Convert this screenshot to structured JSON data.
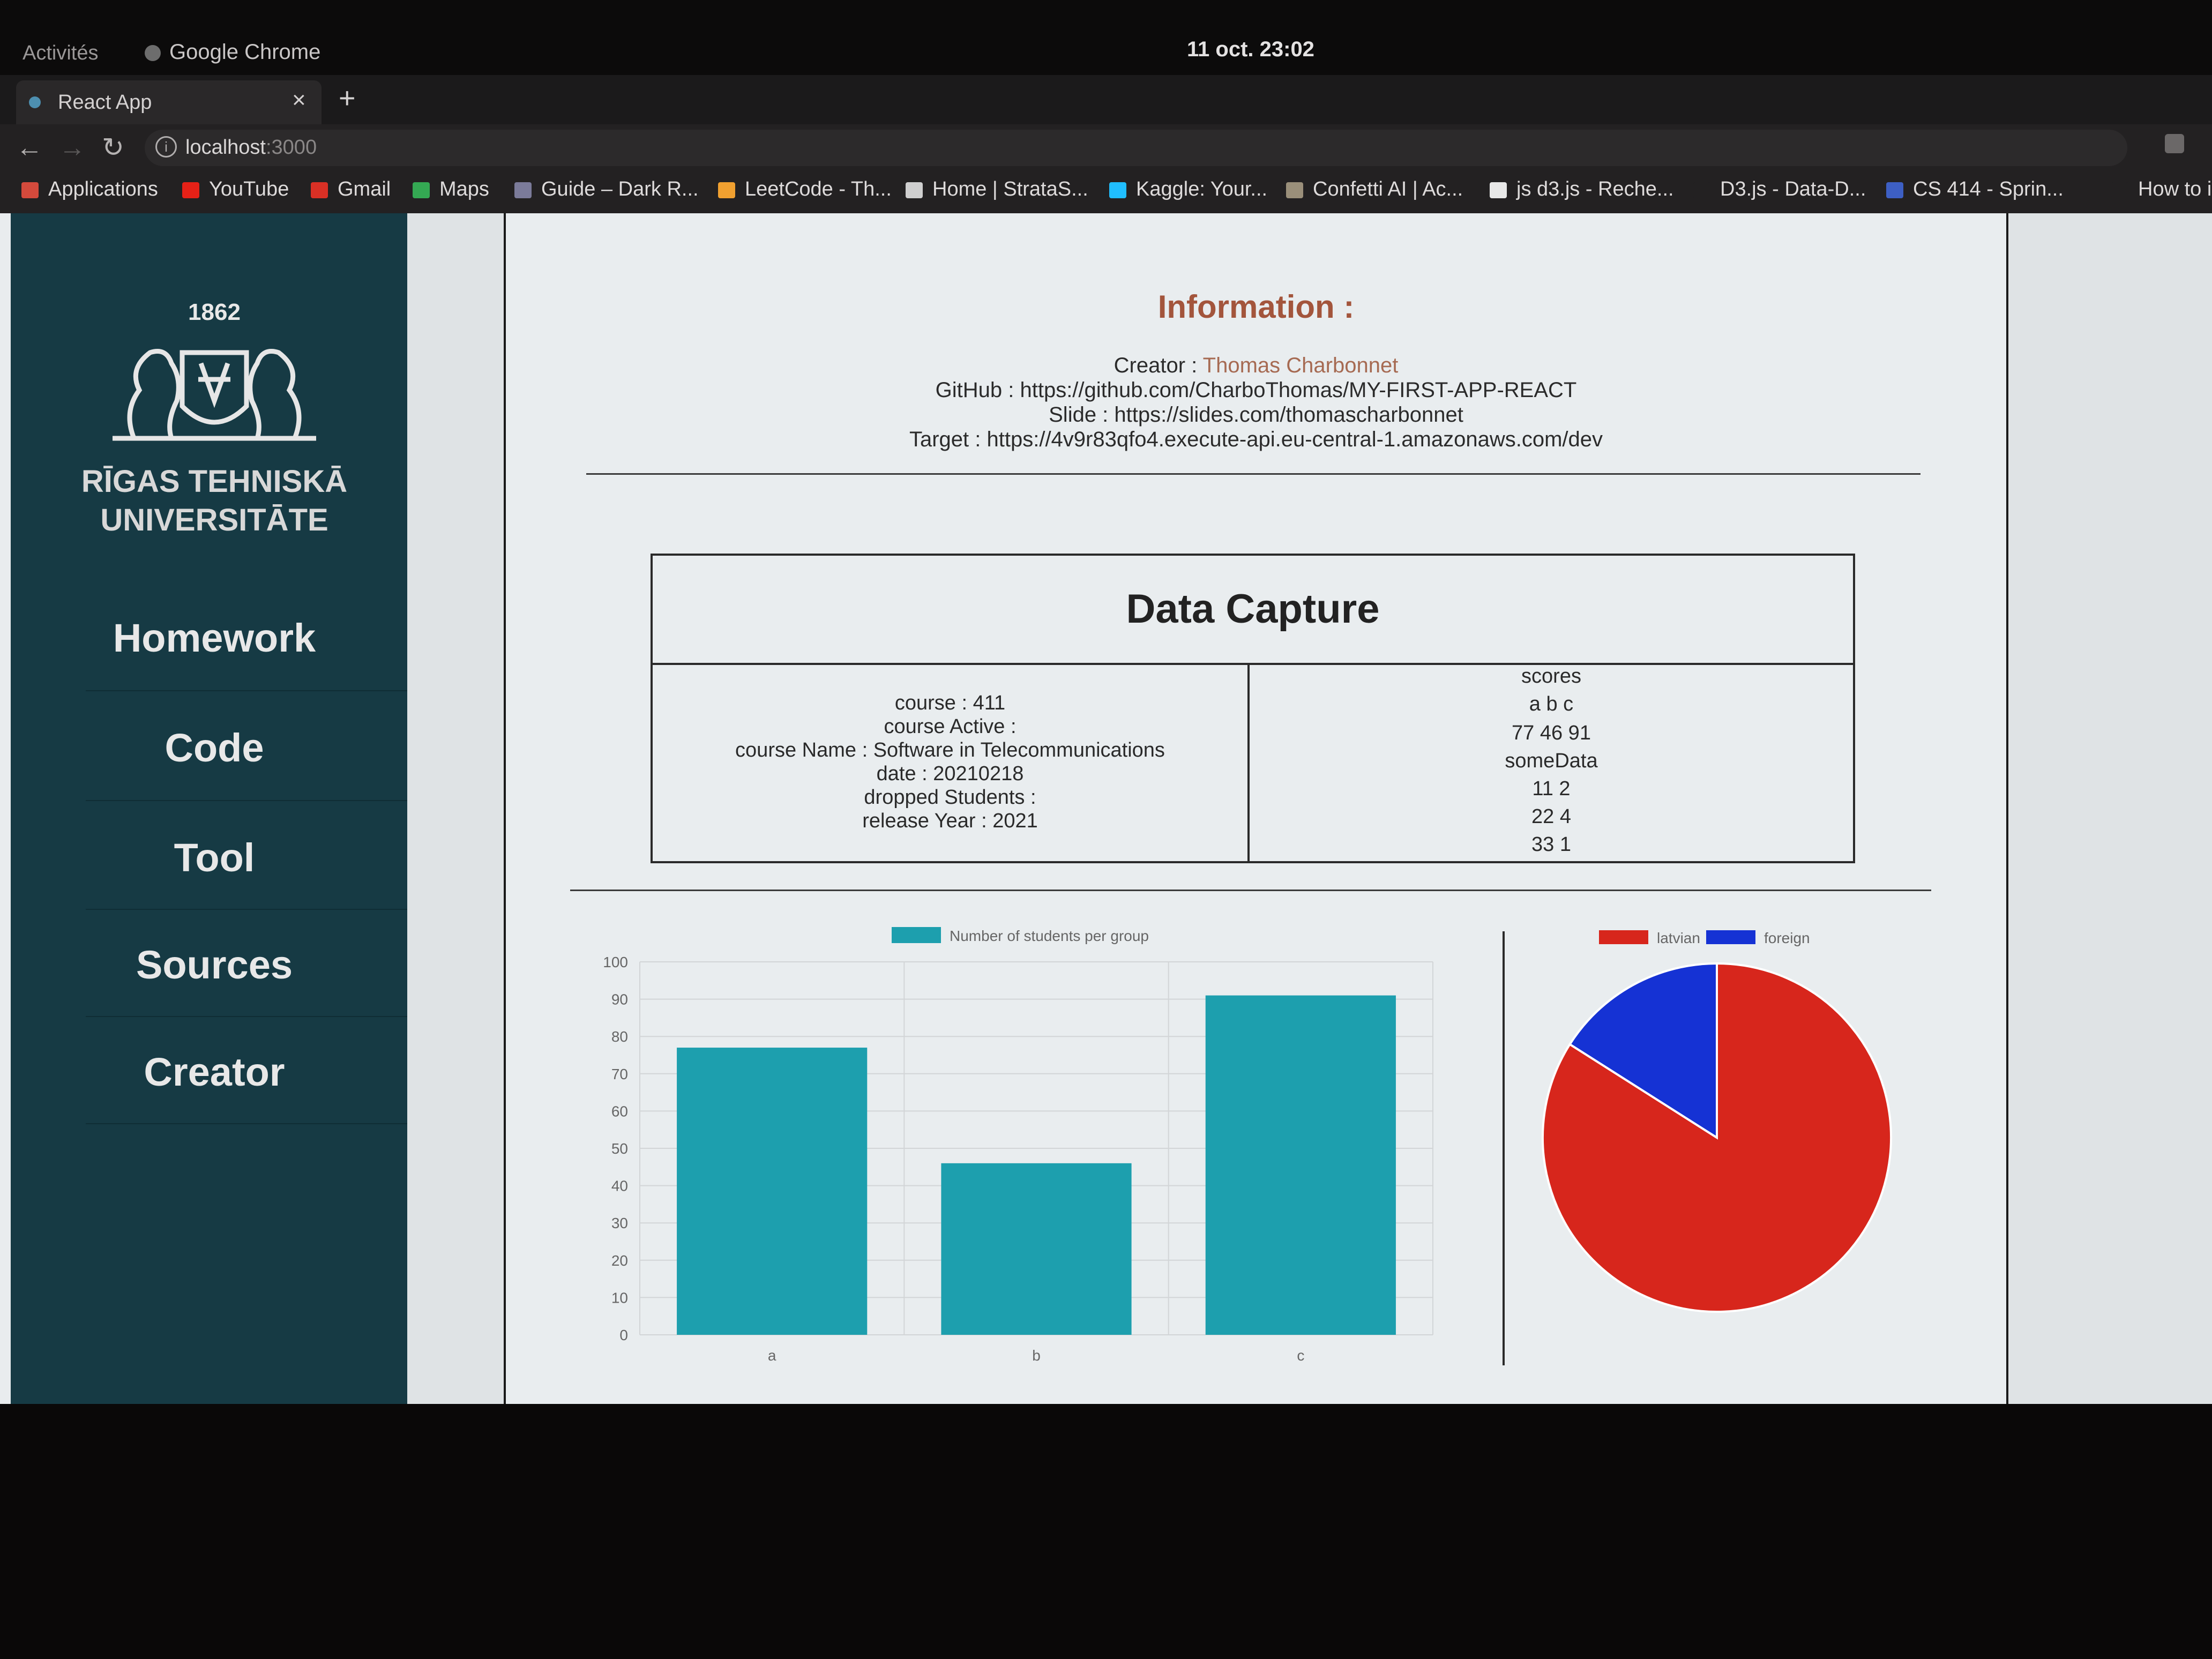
{
  "os": {
    "activities": "Activités",
    "app_name": "Google Chrome",
    "clock": "11 oct.  23:02"
  },
  "browser": {
    "tab_title": "React App",
    "tab_close": "×",
    "new_tab": "+",
    "url_host": "localhost",
    "url_port": ":3000",
    "bookmarks": [
      {
        "label": "Applications",
        "icon_color": "#d44a3c"
      },
      {
        "label": "YouTube",
        "icon_color": "#e62117"
      },
      {
        "label": "Gmail",
        "icon_color": "#d93025"
      },
      {
        "label": "Maps",
        "icon_color": "#34a853"
      },
      {
        "label": "Guide – Dark R...",
        "icon_color": "#7b7b9a"
      },
      {
        "label": "LeetCode - Th...",
        "icon_color": "#f0a030"
      },
      {
        "label": "Home | StrataS...",
        "icon_color": "#cfcfcf"
      },
      {
        "label": "Kaggle: Your...",
        "icon_color": "#20beff"
      },
      {
        "label": "Confetti AI | Ac...",
        "icon_color": "#9a8f7a"
      },
      {
        "label": "js d3.js - Reche...",
        "icon_color": "#e8e8e8"
      },
      {
        "label": "D3.js - Data-D...",
        "icon_color": "#232122"
      },
      {
        "label": "CS 414 - Sprin...",
        "icon_color": "#3d5fc4"
      },
      {
        "label": "How to inst",
        "icon_color": "#232122"
      }
    ]
  },
  "sidebar": {
    "logo_year": "1862",
    "logo_name_line1": "RĪGAS TEHNISKĀ",
    "logo_name_line2": "UNIVERSITĀTE",
    "items": [
      {
        "label": "Homework"
      },
      {
        "label": "Code"
      },
      {
        "label": "Tool"
      },
      {
        "label": "Sources"
      },
      {
        "label": "Creator"
      }
    ]
  },
  "information": {
    "title": "Information :",
    "creator_label": "Creator : ",
    "creator_name": "Thomas Charbonnet",
    "github": "GitHub : https://github.com/CharboThomas/MY-FIRST-APP-REACT",
    "slide": "Slide : https://slides.com/thomascharbonnet",
    "target": "Target : https://4v9r83qfo4.execute-api.eu-central-1.amazonaws.com/dev"
  },
  "data_capture": {
    "title": "Data Capture",
    "left_lines": [
      "course : 411",
      "course Active :",
      "course Name : Software in Telecommunications",
      "date : 20210218",
      "dropped Students :",
      "release Year : 2021"
    ],
    "right_lines": [
      "scores",
      "a   b   c",
      "77 46 91",
      "someData",
      "11     2",
      "22     4",
      "33     1"
    ]
  },
  "chart_data": [
    {
      "type": "bar",
      "title": "",
      "categories": [
        "a",
        "b",
        "c"
      ],
      "series": [
        {
          "name": "Number of students per group",
          "values": [
            77,
            46,
            91
          ],
          "color": "#1d9fae"
        }
      ],
      "ylim": [
        0,
        100
      ],
      "yticks": [
        0,
        10,
        20,
        30,
        40,
        50,
        60,
        70,
        80,
        90,
        100
      ],
      "grid": true,
      "legend": "top"
    },
    {
      "type": "pie",
      "labels": [
        "latvian",
        "foreign"
      ],
      "values": [
        84,
        16
      ],
      "colors": [
        "#d7261c",
        "#1532d4"
      ],
      "legend": "top"
    }
  ]
}
